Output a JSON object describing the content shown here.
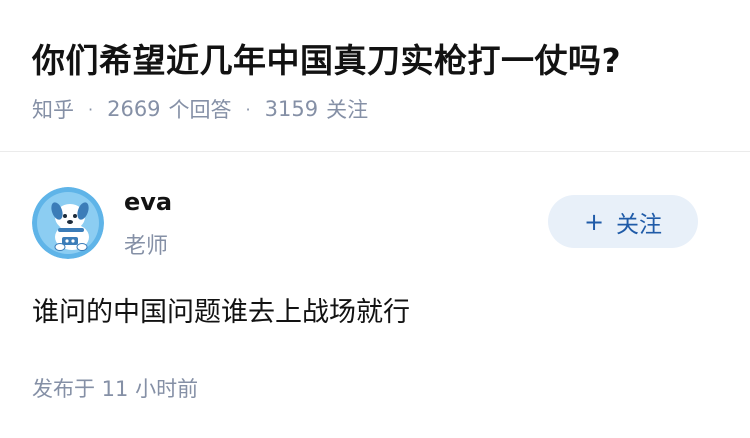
{
  "question": {
    "title": "你们希望近几年中国真刀实枪打一仗吗?",
    "source": "知乎",
    "answer_count": "2669",
    "answer_label": "个回答",
    "follower_count": "3159",
    "follower_label": "关注"
  },
  "answer": {
    "author": {
      "name": "eva",
      "title": "老师",
      "avatar_icon": "dog-avatar-icon"
    },
    "follow_button": {
      "icon": "plus-icon",
      "plus": "+",
      "label": "关注"
    },
    "content": "谁问的中国问题谁去上战场就行",
    "publish_time": "发布于 11 小时前"
  },
  "colors": {
    "title": "#121212",
    "meta": "#8590a6",
    "follow_bg": "#e8f0f9",
    "follow_text": "#1f5ba8",
    "avatar_bg": "#5fb4e8"
  }
}
